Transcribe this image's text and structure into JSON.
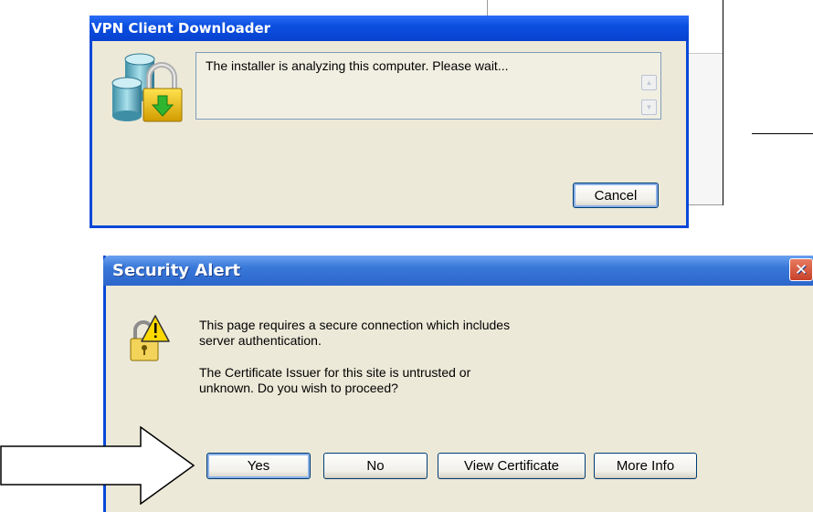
{
  "installer_dialog": {
    "title": "VPN Client Downloader",
    "message": "The installer is analyzing this computer. Please wait...",
    "cancel_label": "Cancel",
    "icon": "database-lock-icon"
  },
  "security_dialog": {
    "title": "Security Alert",
    "line1a": "This page requires a secure connection which includes",
    "line1b": "server authentication.",
    "line2a": "The Certificate Issuer for this site is untrusted or",
    "line2b": "unknown.  Do you wish to proceed?",
    "buttons": {
      "yes": "Yes",
      "no": "No",
      "view_certificate": "View Certificate",
      "more_info": "More Info"
    },
    "icon": "warning-lock-icon",
    "close_icon": "close-icon"
  },
  "annotation": {
    "icon": "arrow-right-icon"
  },
  "colors": {
    "xp_blue": "#0a48d8",
    "dialog_face": "#ece9d8",
    "close_red": "#c8412a"
  }
}
